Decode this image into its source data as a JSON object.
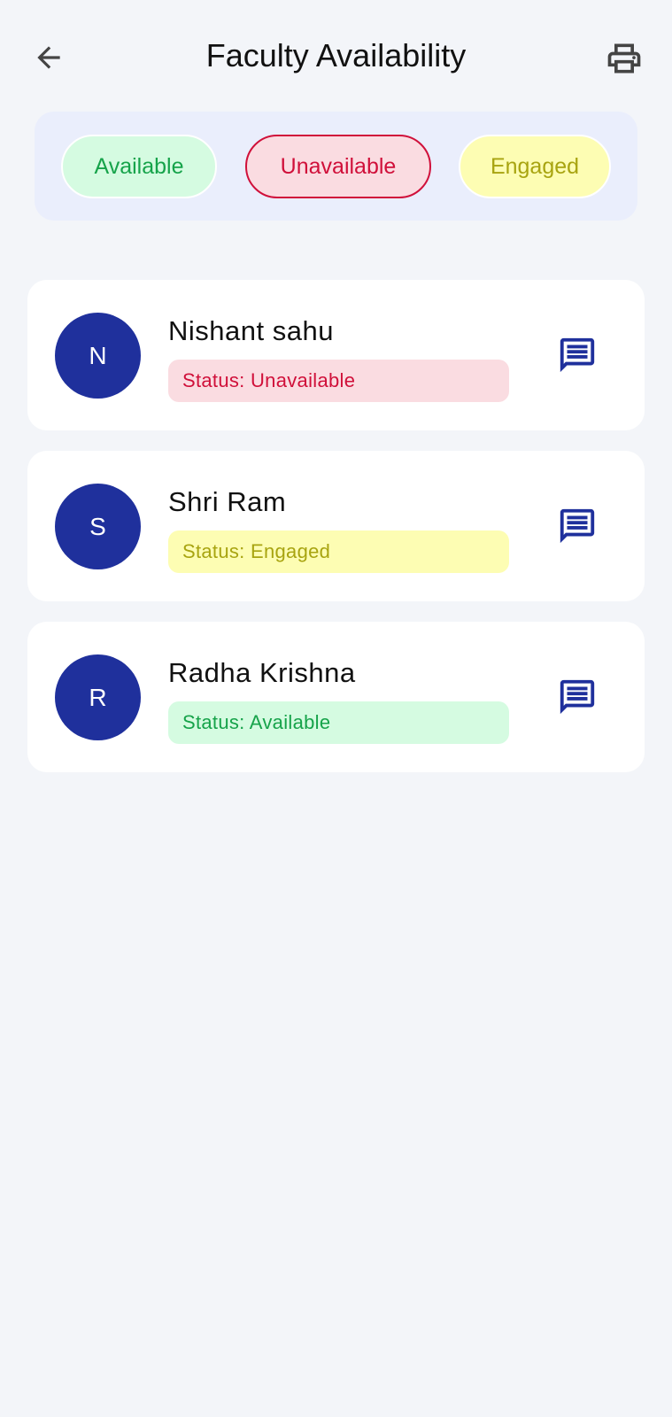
{
  "header": {
    "title": "Faculty Availability",
    "back_icon": "arrow-left-icon",
    "print_icon": "printer-icon"
  },
  "filters": [
    {
      "label": "Available",
      "selected": false
    },
    {
      "label": "Unavailable",
      "selected": true
    },
    {
      "label": "Engaged",
      "selected": false
    }
  ],
  "faculty": [
    {
      "initial": "N",
      "name": "Nishant sahu",
      "status": "Status: Unavailable",
      "status_key": "unavailable"
    },
    {
      "initial": "S",
      "name": "Shri Ram",
      "status": "Status: Engaged",
      "status_key": "engaged"
    },
    {
      "initial": "R",
      "name": "Radha Krishna",
      "status": "Status: Available",
      "status_key": "available"
    }
  ],
  "colors": {
    "background": "#f3f5f9",
    "avatar": "#1f309c",
    "available_bg": "#d5fbe1",
    "available_text": "#16a34a",
    "unavailable_bg": "#fadce1",
    "unavailable_text": "#d0103a",
    "engaged_bg": "#fdfdb3",
    "engaged_text": "#a8a410"
  }
}
